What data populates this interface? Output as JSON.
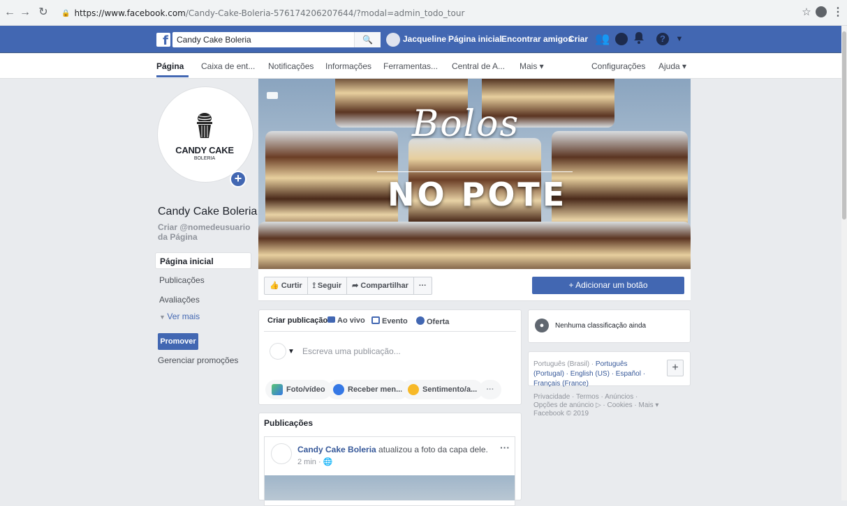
{
  "browser": {
    "url_host": "https://www.facebook.com",
    "url_rest": "/Candy-Cake-Boleria-576174206207644/?modal=admin_todo_tour"
  },
  "topbar": {
    "search_value": "Candy Cake Boleria",
    "user_name": "Jacqueline",
    "home": "Página inicial",
    "find_friends": "Encontrar amigos",
    "create": "Criar"
  },
  "tabs": [
    "Página",
    "Caixa de ent...",
    "Notificações",
    "Informações",
    "Ferramentas...",
    "Central de A...",
    "Mais ▾",
    "Configurações",
    "Ajuda ▾"
  ],
  "profile": {
    "logo_line1": "CANDY CAKE",
    "logo_line2": "BOLERIA",
    "page_name": "Candy Cake Boleria",
    "username_hint": "Criar @nomedeusuario da Página"
  },
  "leftnav": {
    "items": [
      "Página inicial",
      "Publicações",
      "Avaliações"
    ],
    "see_more": "Ver mais",
    "promote": "Promover",
    "manage_promotions": "Gerenciar promoções"
  },
  "cover": {
    "title_script": "Bolos",
    "title_block": "NO POTE"
  },
  "actions": {
    "like": "Curtir",
    "follow": "Seguir",
    "share": "Compartilhar",
    "more": "···",
    "add_button": "+ Adicionar um botão"
  },
  "composer": {
    "create_post": "Criar publicação",
    "live": "Ao vivo",
    "event": "Evento",
    "offer": "Oferta",
    "placeholder": "Escreva uma publicação...",
    "photo_video": "Foto/vídeo",
    "receive_messages": "Receber men...",
    "feeling": "Sentimento/a...",
    "more": "···"
  },
  "posts": {
    "title": "Publicações",
    "author": "Candy Cake Boleria",
    "action_text": " atualizou a foto da capa dele.",
    "time": "2 min · ",
    "more": "···"
  },
  "right": {
    "rating": "Nenhuma classificação ainda",
    "lang_current": "Português (Brasil) · ",
    "lang_others": "Português (Portugal) · English (US) · Español · Français (France)",
    "footer_line1": "Privacidade · Termos · Anúncios ·",
    "footer_line2": "Opções de anúncio ▷ · Cookies · Mais ▾",
    "footer_line3": "Facebook © 2019"
  },
  "colors": {
    "fb_blue": "#4267b2",
    "link": "#365899",
    "page_bg": "#e9ebee"
  }
}
